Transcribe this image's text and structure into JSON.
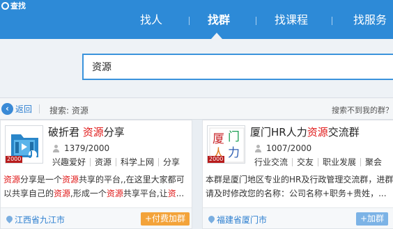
{
  "app": {
    "title": "查找"
  },
  "tabs": [
    {
      "label": "找人"
    },
    {
      "label": "找群"
    },
    {
      "label": "找课程"
    },
    {
      "label": "找服务"
    }
  ],
  "search": {
    "value": "资源"
  },
  "backbar": {
    "back_label": "返回",
    "search_label": "搜索: 资源",
    "not_found_label": "搜索不到我的群？"
  },
  "cards": [
    {
      "title_pre": "破折君 ",
      "title_hl": "资源",
      "title_post": "分享",
      "members": "1379/2000",
      "level": "2000",
      "tags": [
        "兴趣爱好",
        "资源",
        "科学上网",
        "分享"
      ],
      "desc": [
        {
          "t": "资源",
          "h": true
        },
        {
          "t": "分享是一个",
          "h": false
        },
        {
          "t": "资源",
          "h": true
        },
        {
          "t": "共享的平台,,在这里大家都可以共享自己的",
          "h": false
        },
        {
          "t": "资源",
          "h": true
        },
        {
          "t": ",形成一个",
          "h": false
        },
        {
          "t": "资源",
          "h": true
        },
        {
          "t": "共享平台,让",
          "h": false
        },
        {
          "t": "资",
          "h": true
        },
        {
          "t": "...",
          "h": false
        }
      ],
      "location": "江西省九江市",
      "join_label": "+付费加群"
    },
    {
      "title_pre": "厦门HR人力",
      "title_hl": "资源",
      "title_post": "交流群",
      "members": "1007/2000",
      "level": "2000",
      "avatar_chars": [
        "厦",
        "门",
        "人",
        "力"
      ],
      "tags": [
        "行业交流",
        "交友",
        "职业发展",
        "聚会"
      ],
      "desc": [
        {
          "t": "本群是厦门地区专业的HR及行政管理交流群，进群请及时修改您的名称：公司名称+职务+贵姓，...",
          "h": false
        }
      ],
      "location": "福建省厦门市",
      "join_label": "+加群"
    }
  ]
}
